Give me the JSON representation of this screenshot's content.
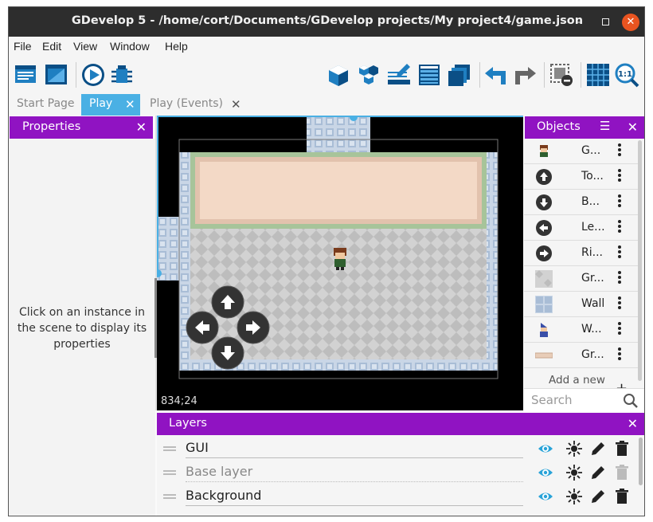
{
  "window": {
    "title": "GDevelop 5 - /home/cort/Documents/GDevelop projects/My project4/game.json",
    "minimize": "–",
    "close": "✕"
  },
  "menu": [
    "File",
    "Edit",
    "View",
    "Window",
    "Help"
  ],
  "tabs": [
    {
      "label": "Start Page",
      "active": false,
      "closable": false
    },
    {
      "label": "Play",
      "active": true,
      "closable": true
    },
    {
      "label": "Play (Events)",
      "active": false,
      "closable": true
    }
  ],
  "tab_close": "✕",
  "properties": {
    "title": "Properties",
    "close": "✕",
    "message": "Click on an instance in the scene to display its properties"
  },
  "scene": {
    "coordinates": "834;24"
  },
  "objects": {
    "title": "Objects",
    "close": "✕",
    "items": [
      {
        "label": "G...",
        "icon": "player-sprite-icon"
      },
      {
        "label": "To...",
        "icon": "arrow-up-circle-icon"
      },
      {
        "label": "B...",
        "icon": "arrow-down-circle-icon"
      },
      {
        "label": "Le...",
        "icon": "arrow-left-circle-icon"
      },
      {
        "label": "Ri...",
        "icon": "arrow-right-circle-icon"
      },
      {
        "label": "Gr...",
        "icon": "grass-tile-icon"
      },
      {
        "label": "Wall",
        "icon": "wall-tile-icon"
      },
      {
        "label": "W...",
        "icon": "wizard-sprite-icon"
      },
      {
        "label": "Gr...",
        "icon": "panel-tile-icon"
      }
    ],
    "add_new": "Add a new",
    "add_plus": "+",
    "search_placeholder": "Search"
  },
  "layers": {
    "title": "Layers",
    "close": "✕",
    "items": [
      {
        "name": "GUI",
        "dim": false
      },
      {
        "name": "Base layer",
        "dim": true
      },
      {
        "name": "Background",
        "dim": false
      }
    ]
  },
  "colors": {
    "panel_header": "#9013c2",
    "active_tab": "#4ab0e4",
    "title_bar": "#2d2d2d",
    "close_button": "#e95420",
    "eye_icon": "#29a3d8"
  }
}
